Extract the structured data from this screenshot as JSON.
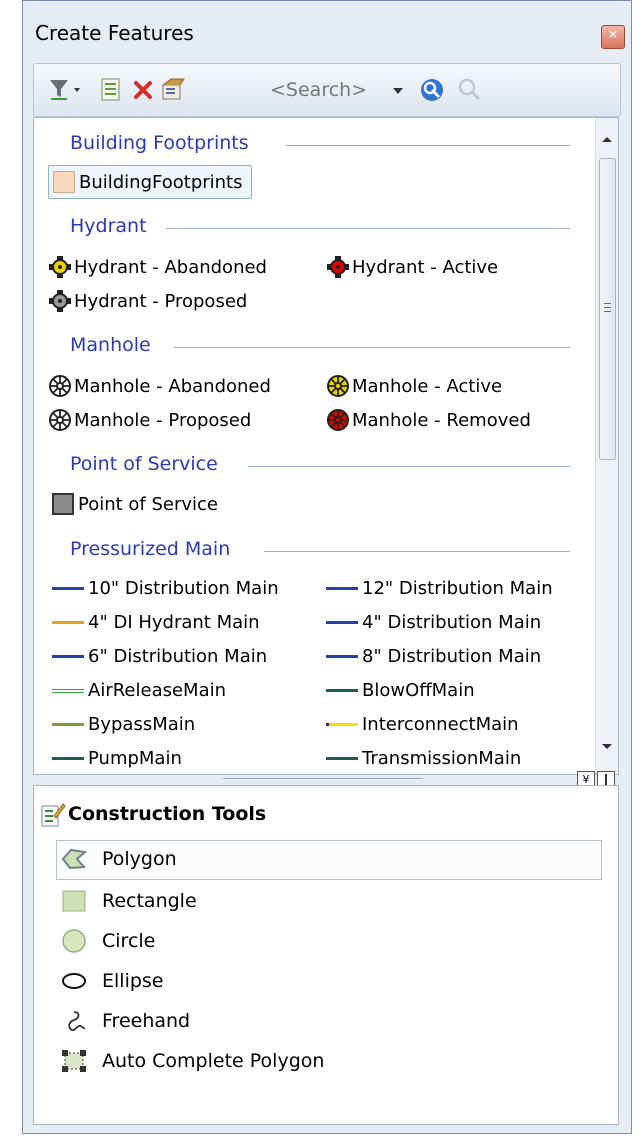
{
  "window": {
    "title": "Create Features"
  },
  "toolbar": {
    "search_placeholder": "<Search>"
  },
  "groups": {
    "building": {
      "label": "Building Footprints",
      "items": [
        "BuildingFootprints"
      ]
    },
    "hydrant": {
      "label": "Hydrant",
      "items": [
        "Hydrant - Abandoned",
        "Hydrant - Active",
        "Hydrant - Proposed"
      ]
    },
    "manhole": {
      "label": "Manhole",
      "items": [
        "Manhole - Abandoned",
        "Manhole - Active",
        "Manhole - Proposed",
        "Manhole - Removed"
      ]
    },
    "service": {
      "label": "Point of Service",
      "items": [
        "Point of Service"
      ]
    },
    "main": {
      "label": "Pressurized Main",
      "items": [
        "10\" Distribution Main",
        "12\" Distribution Main",
        "4\" DI Hydrant Main",
        "4\" Distribution Main",
        "6\" Distribution Main",
        "8\" Distribution Main",
        "AirReleaseMain",
        "BlowOffMain",
        "BypassMain",
        "InterconnectMain",
        "PumpMain",
        "TransmissionMain"
      ]
    }
  },
  "colors": {
    "hydrant_abandoned": "#e8d300",
    "hydrant_active": "#e00000",
    "hydrant_proposed": "#9a9a9a",
    "building_fill": "#f7d8bd",
    "service_fill": "#8a8a8a",
    "line_blue": "#2443a8",
    "line_orange": "#e3a223",
    "line_green": "#31a646",
    "line_teal": "#1f5c57",
    "line_olive": "#7a9d3a",
    "line_yellow": "#f2e200"
  },
  "construction_tools": {
    "title": "Construction Tools",
    "items": [
      "Polygon",
      "Rectangle",
      "Circle",
      "Ellipse",
      "Freehand",
      "Auto Complete Polygon"
    ]
  }
}
